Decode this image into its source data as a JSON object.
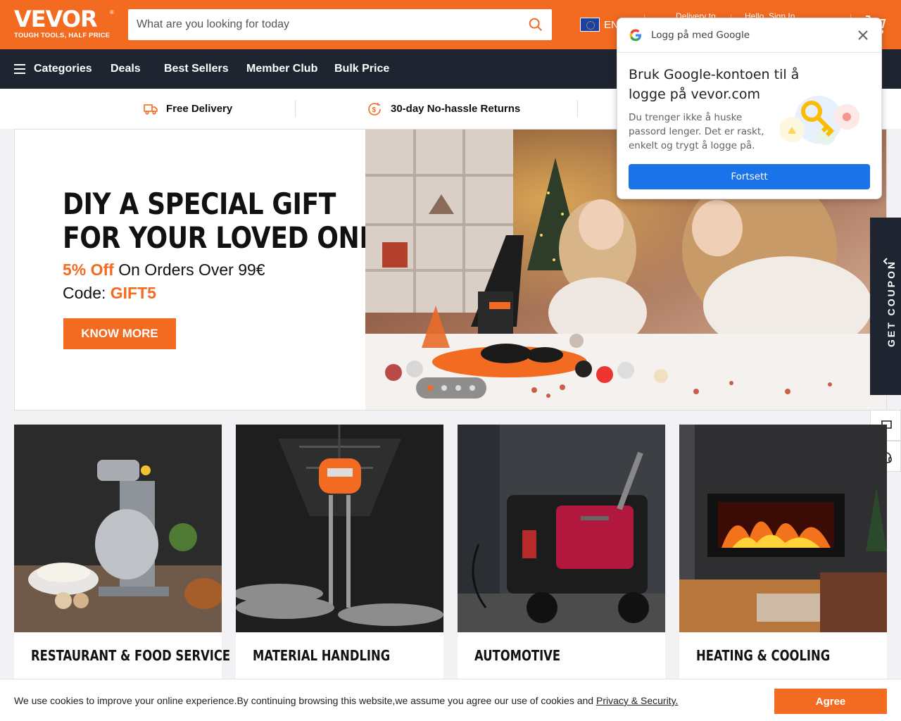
{
  "header": {
    "logo_text": "VEVOR",
    "logo_tagline": "TOUGH TOOLS, HALF PRICE",
    "search_placeholder": "What are you looking for today",
    "language": "EN",
    "delivery_label": "Delivery to",
    "signin_label": "Hello, Sign In"
  },
  "nav": {
    "categories": "Categories",
    "deals": "Deals",
    "best_sellers": "Best Sellers",
    "member_club": "Member Club",
    "bulk_price": "Bulk Price"
  },
  "benefits": {
    "free_delivery": "Free Delivery",
    "returns": "30-day No-hassle Returns"
  },
  "hero": {
    "title_line1": "DIY A SPECIAL GIFT",
    "title_line2": "FOR YOUR LOVED ONES",
    "offer_highlight": "5% Off",
    "offer_rest": " On Orders Over 99€",
    "code_label": "Code: ",
    "code_value": "GIFT5",
    "button": "KNOW MORE",
    "slide_count": 4,
    "active_slide": 1
  },
  "side": {
    "coupon": "GET COUPON"
  },
  "categories": [
    {
      "title": "RESTAURANT & FOOD SERVICE"
    },
    {
      "title": "MATERIAL HANDLING"
    },
    {
      "title": "AUTOMOTIVE"
    },
    {
      "title": "HEATING & COOLING"
    }
  ],
  "cookie": {
    "text": "We use cookies to improve your online experience.By continuing browsing this website,we assume you agree our use of cookies and ",
    "link": "Privacy & Security.",
    "agree": "Agree"
  },
  "google_popup": {
    "header": "Logg på med Google",
    "title": "Bruk Google-kontoen til å logge på vevor.com",
    "body": "Du trenger ikke å huske passord lenger. Det er raskt, enkelt og trygt å logge på.",
    "button": "Fortsett"
  },
  "colors": {
    "brand_orange": "#f26b21",
    "nav_dark": "#1f2530",
    "google_blue": "#1a73e8"
  }
}
